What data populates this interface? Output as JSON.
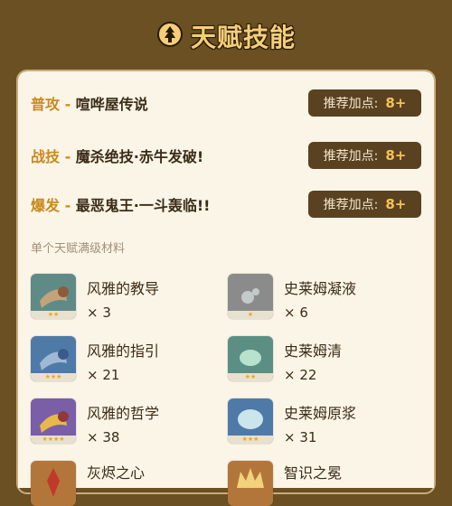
{
  "header": {
    "title": "天赋技能",
    "icon": "talent-emblem-icon"
  },
  "talents": [
    {
      "type": "普攻",
      "sep": " - ",
      "name": "喧哗屋传说",
      "rec_label": "推荐加点:",
      "rec_value": "8+"
    },
    {
      "type": "战技",
      "sep": " - ",
      "name": "魔杀绝技·赤牛发破!",
      "rec_label": "推荐加点:",
      "rec_value": "8+"
    },
    {
      "type": "爆发",
      "sep": " - ",
      "name": "最恶鬼王·一斗轰临!!",
      "rec_label": "推荐加点:",
      "rec_value": "8+"
    }
  ],
  "materials": {
    "title": "单个天赋满级材料",
    "items": [
      {
        "name": "风雅的教导",
        "count": "× 3",
        "icon": "teachings-book-icon",
        "bg": "#5f8b86",
        "stars": "★★"
      },
      {
        "name": "史莱姆凝液",
        "count": "× 6",
        "icon": "slime-condensate-icon",
        "bg": "#8b8b8b",
        "stars": "★"
      },
      {
        "name": "风雅的指引",
        "count": "× 21",
        "icon": "guide-book-icon",
        "bg": "#4f7aa8",
        "stars": "★★★"
      },
      {
        "name": "史莱姆清",
        "count": "× 22",
        "icon": "slime-secretions-icon",
        "bg": "#5b8f83",
        "stars": "★★"
      },
      {
        "name": "风雅的哲学",
        "count": "× 38",
        "icon": "philosophies-book-icon",
        "bg": "#7a5ea8",
        "stars": "★★★★"
      },
      {
        "name": "史莱姆原浆",
        "count": "× 31",
        "icon": "slime-concentrate-icon",
        "bg": "#4f7aa8",
        "stars": "★★★"
      },
      {
        "name": "灰烬之心",
        "count": "",
        "icon": "ashen-heart-icon",
        "bg": "#b3763a",
        "stars": ""
      },
      {
        "name": "智识之冕",
        "count": "",
        "icon": "crown-of-insight-icon",
        "bg": "#b3763a",
        "stars": ""
      }
    ]
  },
  "colors": {
    "background": "#6b5023",
    "card": "#fbf5e8",
    "accent": "#c98a1e",
    "badge": "#5a4221",
    "badge_value": "#f6c350"
  }
}
